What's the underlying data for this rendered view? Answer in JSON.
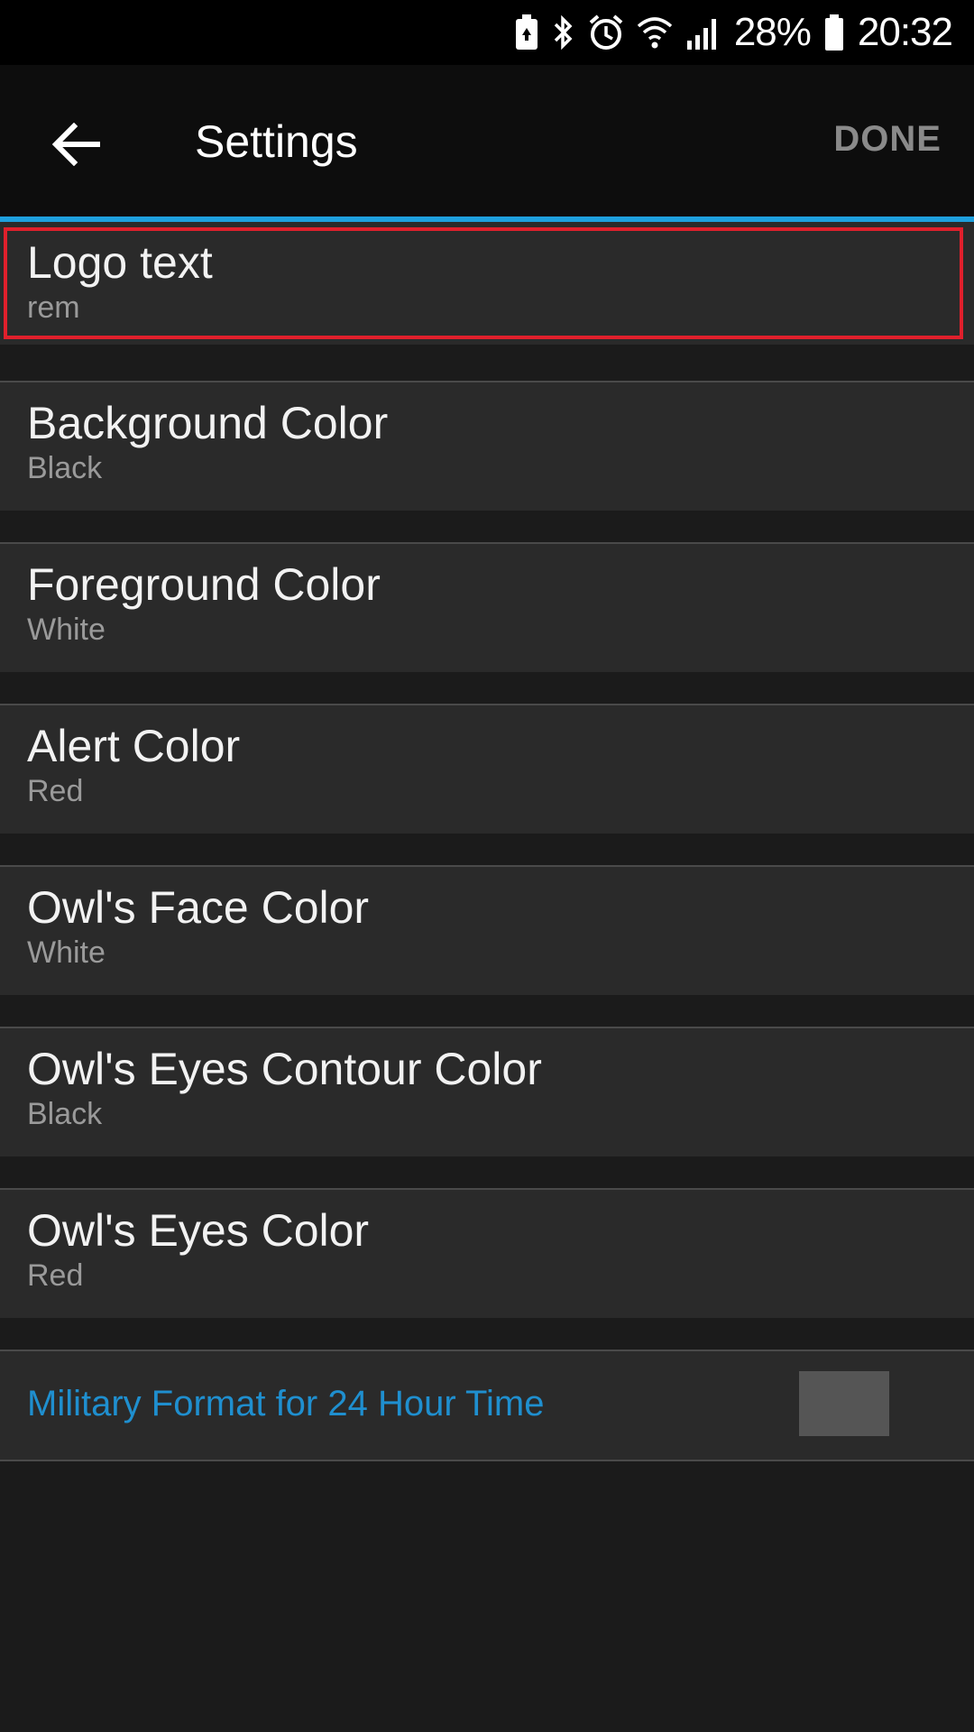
{
  "status_bar": {
    "battery_percent": "28%",
    "time": "20:32",
    "icons": [
      "battery-saver-icon",
      "bluetooth-icon",
      "alarm-icon",
      "wifi-icon",
      "signal-icon",
      "battery-icon"
    ]
  },
  "app_bar": {
    "title": "Settings",
    "done_label": "DONE",
    "back_icon": "arrow-left-icon"
  },
  "settings": [
    {
      "title": "Logo text",
      "summary": "rem"
    },
    {
      "title": "Background Color",
      "summary": "Black"
    },
    {
      "title": "Foreground Color",
      "summary": "White"
    },
    {
      "title": "Alert Color",
      "summary": "Red"
    },
    {
      "title": "Owl's Face Color",
      "summary": "White"
    },
    {
      "title": "Owl's Eyes Contour Color",
      "summary": "Black"
    },
    {
      "title": "Owl's Eyes Color",
      "summary": "Red"
    }
  ],
  "toggle": {
    "label": "Military Format for 24 Hour Time",
    "checked": false
  },
  "colors": {
    "accent": "#1ea0de",
    "highlight_border": "#e0202c",
    "toggle_label": "#1f8fcf"
  }
}
